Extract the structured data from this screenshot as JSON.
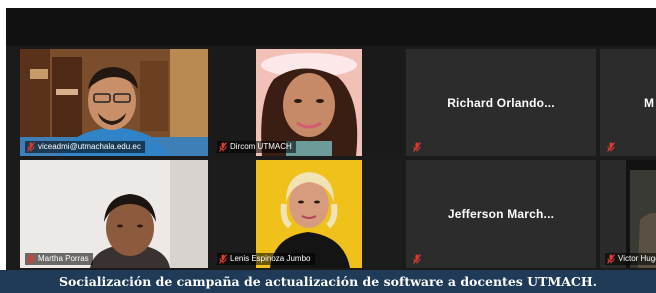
{
  "meeting": {
    "participants": [
      {
        "id": "p1",
        "name": "viceadmi@utmachala.edu.ec",
        "video": true,
        "muted": true
      },
      {
        "id": "p2",
        "name": "Dircom UTMACH",
        "video": true,
        "muted": true
      },
      {
        "id": "p3",
        "name": "Richard Orlando...",
        "video": false,
        "muted": true
      },
      {
        "id": "p4",
        "name": "M",
        "video": false,
        "muted": true
      },
      {
        "id": "p5",
        "name": "Martha Porras",
        "video": true,
        "muted": true
      },
      {
        "id": "p6",
        "name": "Lenis Espinoza Jumbo",
        "video": true,
        "muted": true
      },
      {
        "id": "p7",
        "name": "Jefferson March...",
        "video": false,
        "muted": true
      },
      {
        "id": "p8",
        "name": "Victor Hugo",
        "video": true,
        "muted": true
      }
    ]
  },
  "caption": "Socialización de campaña de actualización de software a docentes UTMACH.",
  "colors": {
    "caption_bg": "#1f3b57",
    "tile_bg": "#2c2c2c",
    "muted_icon": "#e03a2f"
  }
}
